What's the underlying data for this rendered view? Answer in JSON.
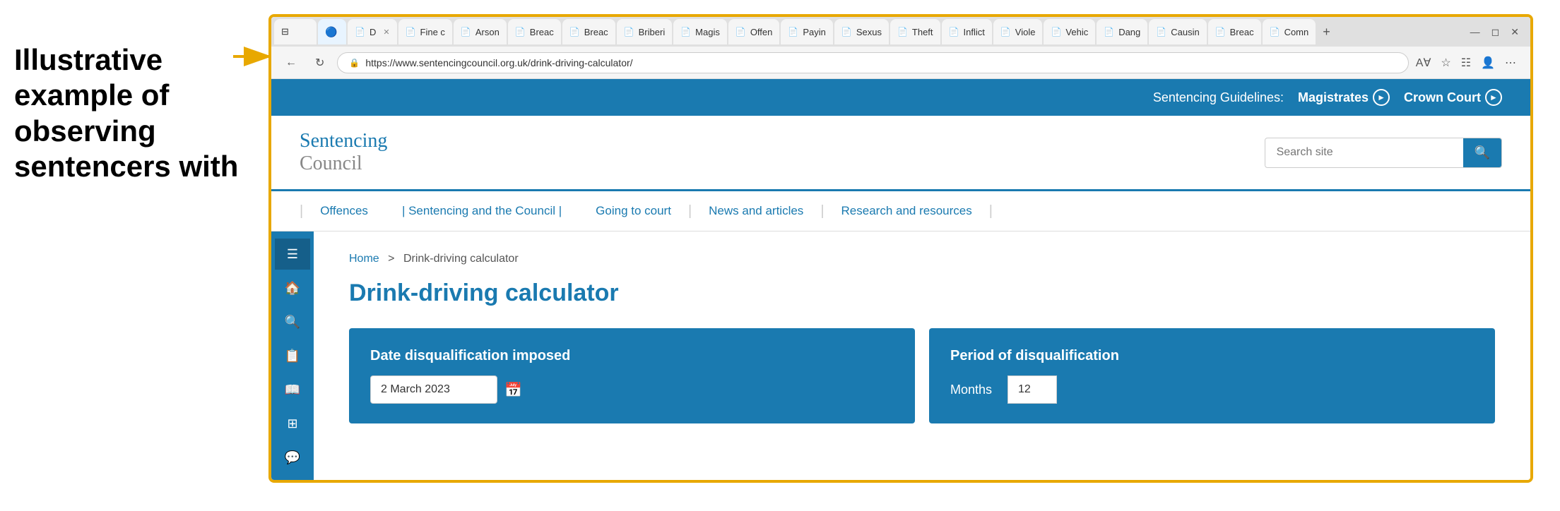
{
  "annotation": {
    "text": "Illustrative example of observing sentencers with"
  },
  "browser": {
    "tabs": [
      {
        "id": "d-tab",
        "label": "D",
        "active": false
      },
      {
        "id": "fine-tab",
        "label": "Fine c",
        "active": false
      },
      {
        "id": "arson-tab",
        "label": "Arson",
        "active": false
      },
      {
        "id": "breach1-tab",
        "label": "Breac",
        "active": false
      },
      {
        "id": "breach2-tab",
        "label": "Breac",
        "active": false
      },
      {
        "id": "bribery-tab",
        "label": "Briberi",
        "active": false
      },
      {
        "id": "magistrates-tab",
        "label": "Magis",
        "active": false
      },
      {
        "id": "offences-tab",
        "label": "Offen",
        "active": false
      },
      {
        "id": "paying-tab",
        "label": "Payin",
        "active": false
      },
      {
        "id": "sexual-tab",
        "label": "Sexus",
        "active": false
      },
      {
        "id": "theft-tab",
        "label": "Theft",
        "active": false
      },
      {
        "id": "inflict-tab",
        "label": "Inflict",
        "active": false
      },
      {
        "id": "violent-tab",
        "label": "Viole",
        "active": false
      },
      {
        "id": "vehicle-tab",
        "label": "Vehic",
        "active": false
      },
      {
        "id": "dangerous-tab",
        "label": "Dang",
        "active": false
      },
      {
        "id": "causing-tab",
        "label": "Causin",
        "active": false
      },
      {
        "id": "breach3-tab",
        "label": "Breac",
        "active": false
      },
      {
        "id": "comm-tab",
        "label": "Comn",
        "active": false
      }
    ],
    "url": "https://www.sentencingcouncil.org.uk/drink-driving-calculator/"
  },
  "top_banner": {
    "label": "Sentencing Guidelines:",
    "magistrates_link": "Magistrates",
    "crown_court_link": "Crown Court"
  },
  "header": {
    "logo_line1": "Sentencing",
    "logo_line2": "Council",
    "search_placeholder": "Search site"
  },
  "nav": {
    "items": [
      {
        "label": "Offences"
      },
      {
        "label": "| Sentencing and the Council |"
      },
      {
        "label": "Going to court"
      },
      {
        "label": "|"
      },
      {
        "label": "News and articles"
      },
      {
        "label": "|"
      },
      {
        "label": "Research and resources"
      },
      {
        "label": "|"
      }
    ]
  },
  "sidebar": {
    "icons": [
      "☰",
      "🏠",
      "🔍",
      "📋",
      "📖",
      "⊞",
      "💬"
    ]
  },
  "page": {
    "breadcrumb_home": "Home",
    "breadcrumb_sep": ">",
    "breadcrumb_current": "Drink-driving calculator",
    "title": "Drink-driving calculator",
    "card1": {
      "title": "Date disqualification imposed",
      "date_value": "2 March 2023"
    },
    "card2": {
      "title": "Period of disqualification",
      "months_label": "Months",
      "months_value": "12"
    }
  }
}
